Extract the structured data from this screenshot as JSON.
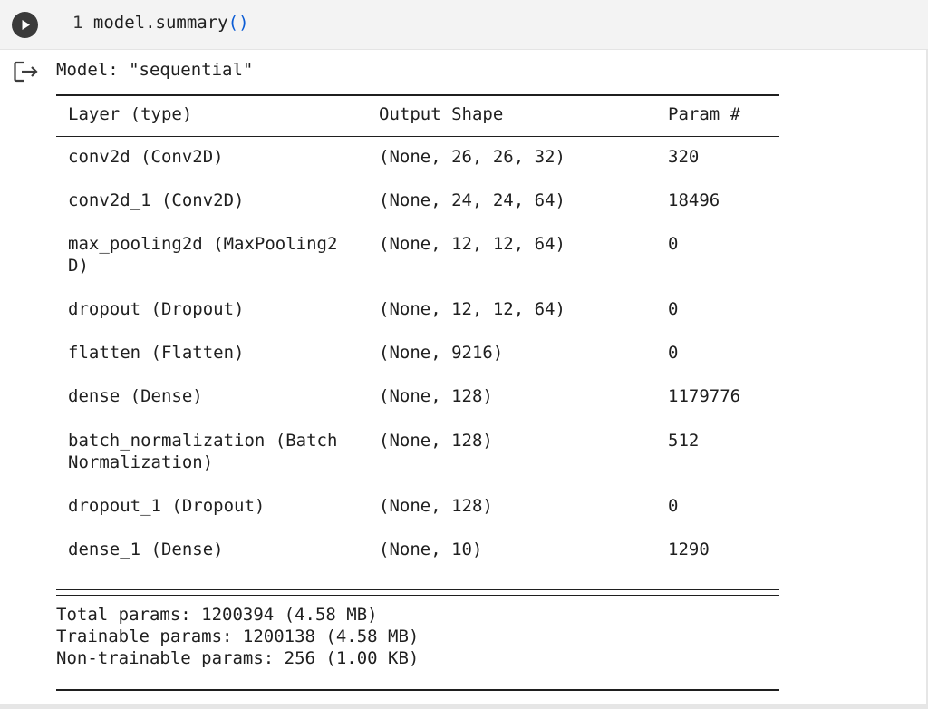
{
  "code_cell": {
    "line_number": "1",
    "code_prefix": "model.summary",
    "code_parens": "()"
  },
  "output": {
    "model_title": "Model: \"sequential\"",
    "headers": {
      "layer": "Layer (type)",
      "shape": "Output Shape",
      "params": "Param #"
    },
    "rows": [
      {
        "layer": "conv2d (Conv2D)",
        "shape": "(None, 26, 26, 32)",
        "params": "320"
      },
      {
        "layer": "conv2d_1 (Conv2D)",
        "shape": "(None, 24, 24, 64)",
        "params": "18496"
      },
      {
        "layer": "max_pooling2d (MaxPooling2",
        "layer_cont": "D)",
        "shape": "(None, 12, 12, 64)",
        "params": "0"
      },
      {
        "layer": "dropout (Dropout)",
        "shape": "(None, 12, 12, 64)",
        "params": "0"
      },
      {
        "layer": "flatten (Flatten)",
        "shape": "(None, 9216)",
        "params": "0"
      },
      {
        "layer": "dense (Dense)",
        "shape": "(None, 128)",
        "params": "1179776"
      },
      {
        "layer": "batch_normalization (Batch",
        "layer_cont": "Normalization)",
        "shape": "(None, 128)",
        "params": "512"
      },
      {
        "layer": "dropout_1 (Dropout)",
        "shape": "(None, 128)",
        "params": "0"
      },
      {
        "layer": "dense_1 (Dense)",
        "shape": "(None, 10)",
        "params": "1290"
      }
    ],
    "total_params": "Total params: 1200394 (4.58 MB)",
    "trainable_params": "Trainable params: 1200138 (4.58 MB)",
    "non_trainable_params": "Non-trainable params: 256 (1.00 KB)"
  },
  "icons": {
    "run": "play-icon",
    "output": "output-arrow-icon"
  }
}
